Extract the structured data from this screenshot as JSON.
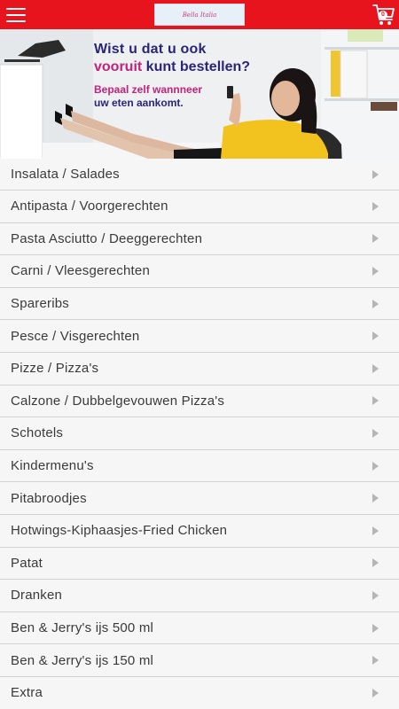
{
  "header": {
    "menu_icon": "hamburger-icon",
    "logo_text": "Bella Italia",
    "cart_icon": "cart-icon",
    "cart_count": "0",
    "colors": {
      "bar": "#e8141d",
      "text": "#ffffff"
    }
  },
  "banner": {
    "line1": "Wist u dat u ook",
    "line2_accent": "vooruit",
    "line2_rest": "kunt bestellen?",
    "line3": "Bepaal zelf wannneer",
    "line4": "uw eten aankomt.",
    "colors": {
      "primary": "#2c2577",
      "accent": "#c3237a"
    }
  },
  "menu": {
    "items": [
      {
        "label": "Insalata / Salades"
      },
      {
        "label": "Antipasta / Voorgerechten"
      },
      {
        "label": "Pasta Asciutto / Deeggerechten"
      },
      {
        "label": "Carni / Vleesgerechten"
      },
      {
        "label": "Spareribs"
      },
      {
        "label": "Pesce / Visgerechten"
      },
      {
        "label": "Pizze / Pizza's"
      },
      {
        "label": "Calzone / Dubbelgevouwen Pizza's"
      },
      {
        "label": "Schotels"
      },
      {
        "label": "Kindermenu's"
      },
      {
        "label": "Pitabroodjes"
      },
      {
        "label": "Hotwings-Kiphaasjes-Fried Chicken"
      },
      {
        "label": "Patat"
      },
      {
        "label": "Dranken"
      },
      {
        "label": "Ben & Jerry's ijs 500 ml"
      },
      {
        "label": "Ben & Jerry's ijs 150 ml"
      },
      {
        "label": "Extra"
      }
    ],
    "chevron_icon": "chevron-right-icon"
  }
}
